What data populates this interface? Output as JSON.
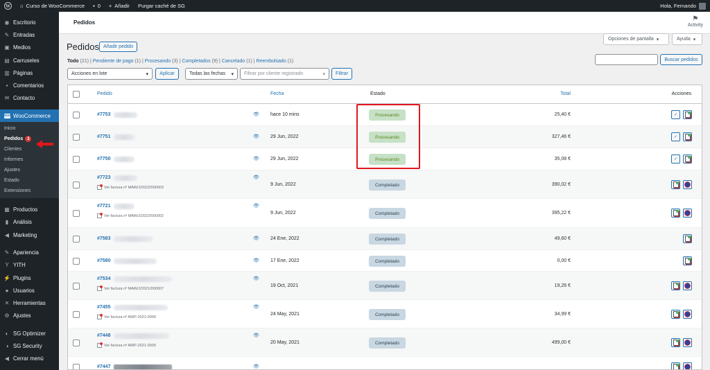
{
  "adminbar": {
    "site_name": "Curso de WooCommerce",
    "comments_count": "0",
    "new_label": "Añadir",
    "purge_label": "Purgar caché de SG",
    "greeting": "Hola, Fernando"
  },
  "sidebar": {
    "items_top": [
      {
        "label": "Escritorio",
        "icon": "dashboard-icon",
        "glyph": "◉"
      },
      {
        "label": "Entradas",
        "icon": "pin-icon",
        "glyph": "✎"
      },
      {
        "label": "Medios",
        "icon": "media-icon",
        "glyph": "▣"
      },
      {
        "label": "Carruseles",
        "icon": "carousel-icon",
        "glyph": "▤"
      },
      {
        "label": "Páginas",
        "icon": "pages-icon",
        "glyph": "▥"
      },
      {
        "label": "Comentarios",
        "icon": "comments-icon",
        "glyph": "▪"
      },
      {
        "label": "Contacto",
        "icon": "mail-icon",
        "glyph": "✉"
      }
    ],
    "woocommerce_label": "WooCommerce",
    "woocommerce_badge": "woo",
    "submenu": [
      {
        "label": "Inicio"
      },
      {
        "label": "Pedidos",
        "count": "3",
        "current": true
      },
      {
        "label": "Clientes"
      },
      {
        "label": "Informes"
      },
      {
        "label": "Ajustes"
      },
      {
        "label": "Estado"
      },
      {
        "label": "Extensiones"
      }
    ],
    "items_bottom": [
      {
        "label": "Productos",
        "icon": "products-icon",
        "glyph": "▦"
      },
      {
        "label": "Análisis",
        "icon": "analytics-icon",
        "glyph": "▮"
      },
      {
        "label": "Marketing",
        "icon": "megaphone-icon",
        "glyph": "◀"
      },
      {
        "label": "Apariencia",
        "icon": "brush-icon",
        "glyph": "✎"
      },
      {
        "label": "YITH",
        "icon": "yith-icon",
        "glyph": "Y"
      },
      {
        "label": "Plugins",
        "icon": "plugin-icon",
        "glyph": "⚡"
      },
      {
        "label": "Usuarios",
        "icon": "users-icon",
        "glyph": "●"
      },
      {
        "label": "Herramientas",
        "icon": "tools-icon",
        "glyph": "✕"
      },
      {
        "label": "Ajustes",
        "icon": "settings-icon",
        "glyph": "⚙"
      },
      {
        "label": "SG Optimizer",
        "icon": "sg-optimizer-icon",
        "glyph": "◐"
      },
      {
        "label": "SG Security",
        "icon": "sg-security-icon",
        "glyph": "◑"
      },
      {
        "label": "Cerrar menú",
        "icon": "collapse-icon",
        "glyph": "◀"
      }
    ]
  },
  "header": {
    "title": "Pedidos",
    "activity_label": "Activity",
    "screen_options": "Opciones de pantalla",
    "help": "Ayuda"
  },
  "page": {
    "heading": "Pedidos",
    "add_button": "Añadir pedido",
    "filters": [
      {
        "label": "Todo",
        "count": "(21)",
        "current": true
      },
      {
        "label": "Pendiente de pago",
        "count": "(1)"
      },
      {
        "label": "Procesando",
        "count": "(3)"
      },
      {
        "label": "Completados",
        "count": "(9)"
      },
      {
        "label": "Cancelado",
        "count": "(1)"
      },
      {
        "label": "Reembolsado",
        "count": "(1)"
      }
    ],
    "search_button": "Buscar pedidos",
    "bulk_actions": "Acciones en lote",
    "apply": "Aplicar",
    "dates": "Todas las fechas",
    "customer_placeholder": "Filtrar por cliente registrado",
    "filter_button": "Filtrar"
  },
  "table": {
    "columns": {
      "order": "Pedido",
      "date": "Fecha",
      "status": "Estado",
      "total": "Total",
      "actions": "Acciones"
    },
    "rows": [
      {
        "order": "#7753",
        "date": "hace 10 mins",
        "status": "Procesando",
        "status_type": "processing",
        "total": "25,40 €",
        "invoice": ""
      },
      {
        "order": "#7751",
        "date": "29 Jun, 2022",
        "status": "Procesando",
        "status_type": "processing",
        "total": "327,46 €",
        "invoice": ""
      },
      {
        "order": "#7750",
        "date": "29 Jun, 2022",
        "status": "Procesando",
        "status_type": "processing",
        "total": "35,08 €",
        "invoice": ""
      },
      {
        "order": "#7723",
        "date": "9 Jun, 2022",
        "status": "Completado",
        "status_type": "completed",
        "total": "390,02 €",
        "invoice": "Ver factura nº MAW/J/2022/000003"
      },
      {
        "order": "#7721",
        "date": "9 Jun, 2022",
        "status": "Completado",
        "status_type": "completed",
        "total": "395,22 €",
        "invoice": "Ver factura nº MAW/J/2022/000002"
      },
      {
        "order": "#7583",
        "date": "24 Ene, 2022",
        "status": "Completado",
        "status_type": "completed",
        "total": "49,60 €",
        "invoice": ""
      },
      {
        "order": "#7580",
        "date": "17 Ene, 2022",
        "status": "Completado",
        "status_type": "completed",
        "total": "0,00 €",
        "invoice": ""
      },
      {
        "order": "#7534",
        "date": "19 Oct, 2021",
        "status": "Completado",
        "status_type": "completed",
        "total": "19,26 €",
        "invoice": "Ver factura nº MAW/J/2021/000007"
      },
      {
        "order": "#7455",
        "date": "24 May, 2021",
        "status": "Completado",
        "status_type": "completed",
        "total": "34,99 €",
        "invoice": "Ver factura nº AWP-2021-0006"
      },
      {
        "order": "#7448",
        "date": "20 May, 2021",
        "status": "Completado",
        "status_type": "completed",
        "total": "499,00 €",
        "invoice": "Ver factura nº AWP-2021-0005"
      },
      {
        "order": "#7447",
        "date": "",
        "status": "",
        "status_type": "",
        "total": "",
        "invoice": ""
      }
    ]
  },
  "colors": {
    "accent": "#2271b1",
    "highlight": "#e1161c",
    "processing": "#c6e1c6",
    "completed": "#c8d7e1"
  }
}
